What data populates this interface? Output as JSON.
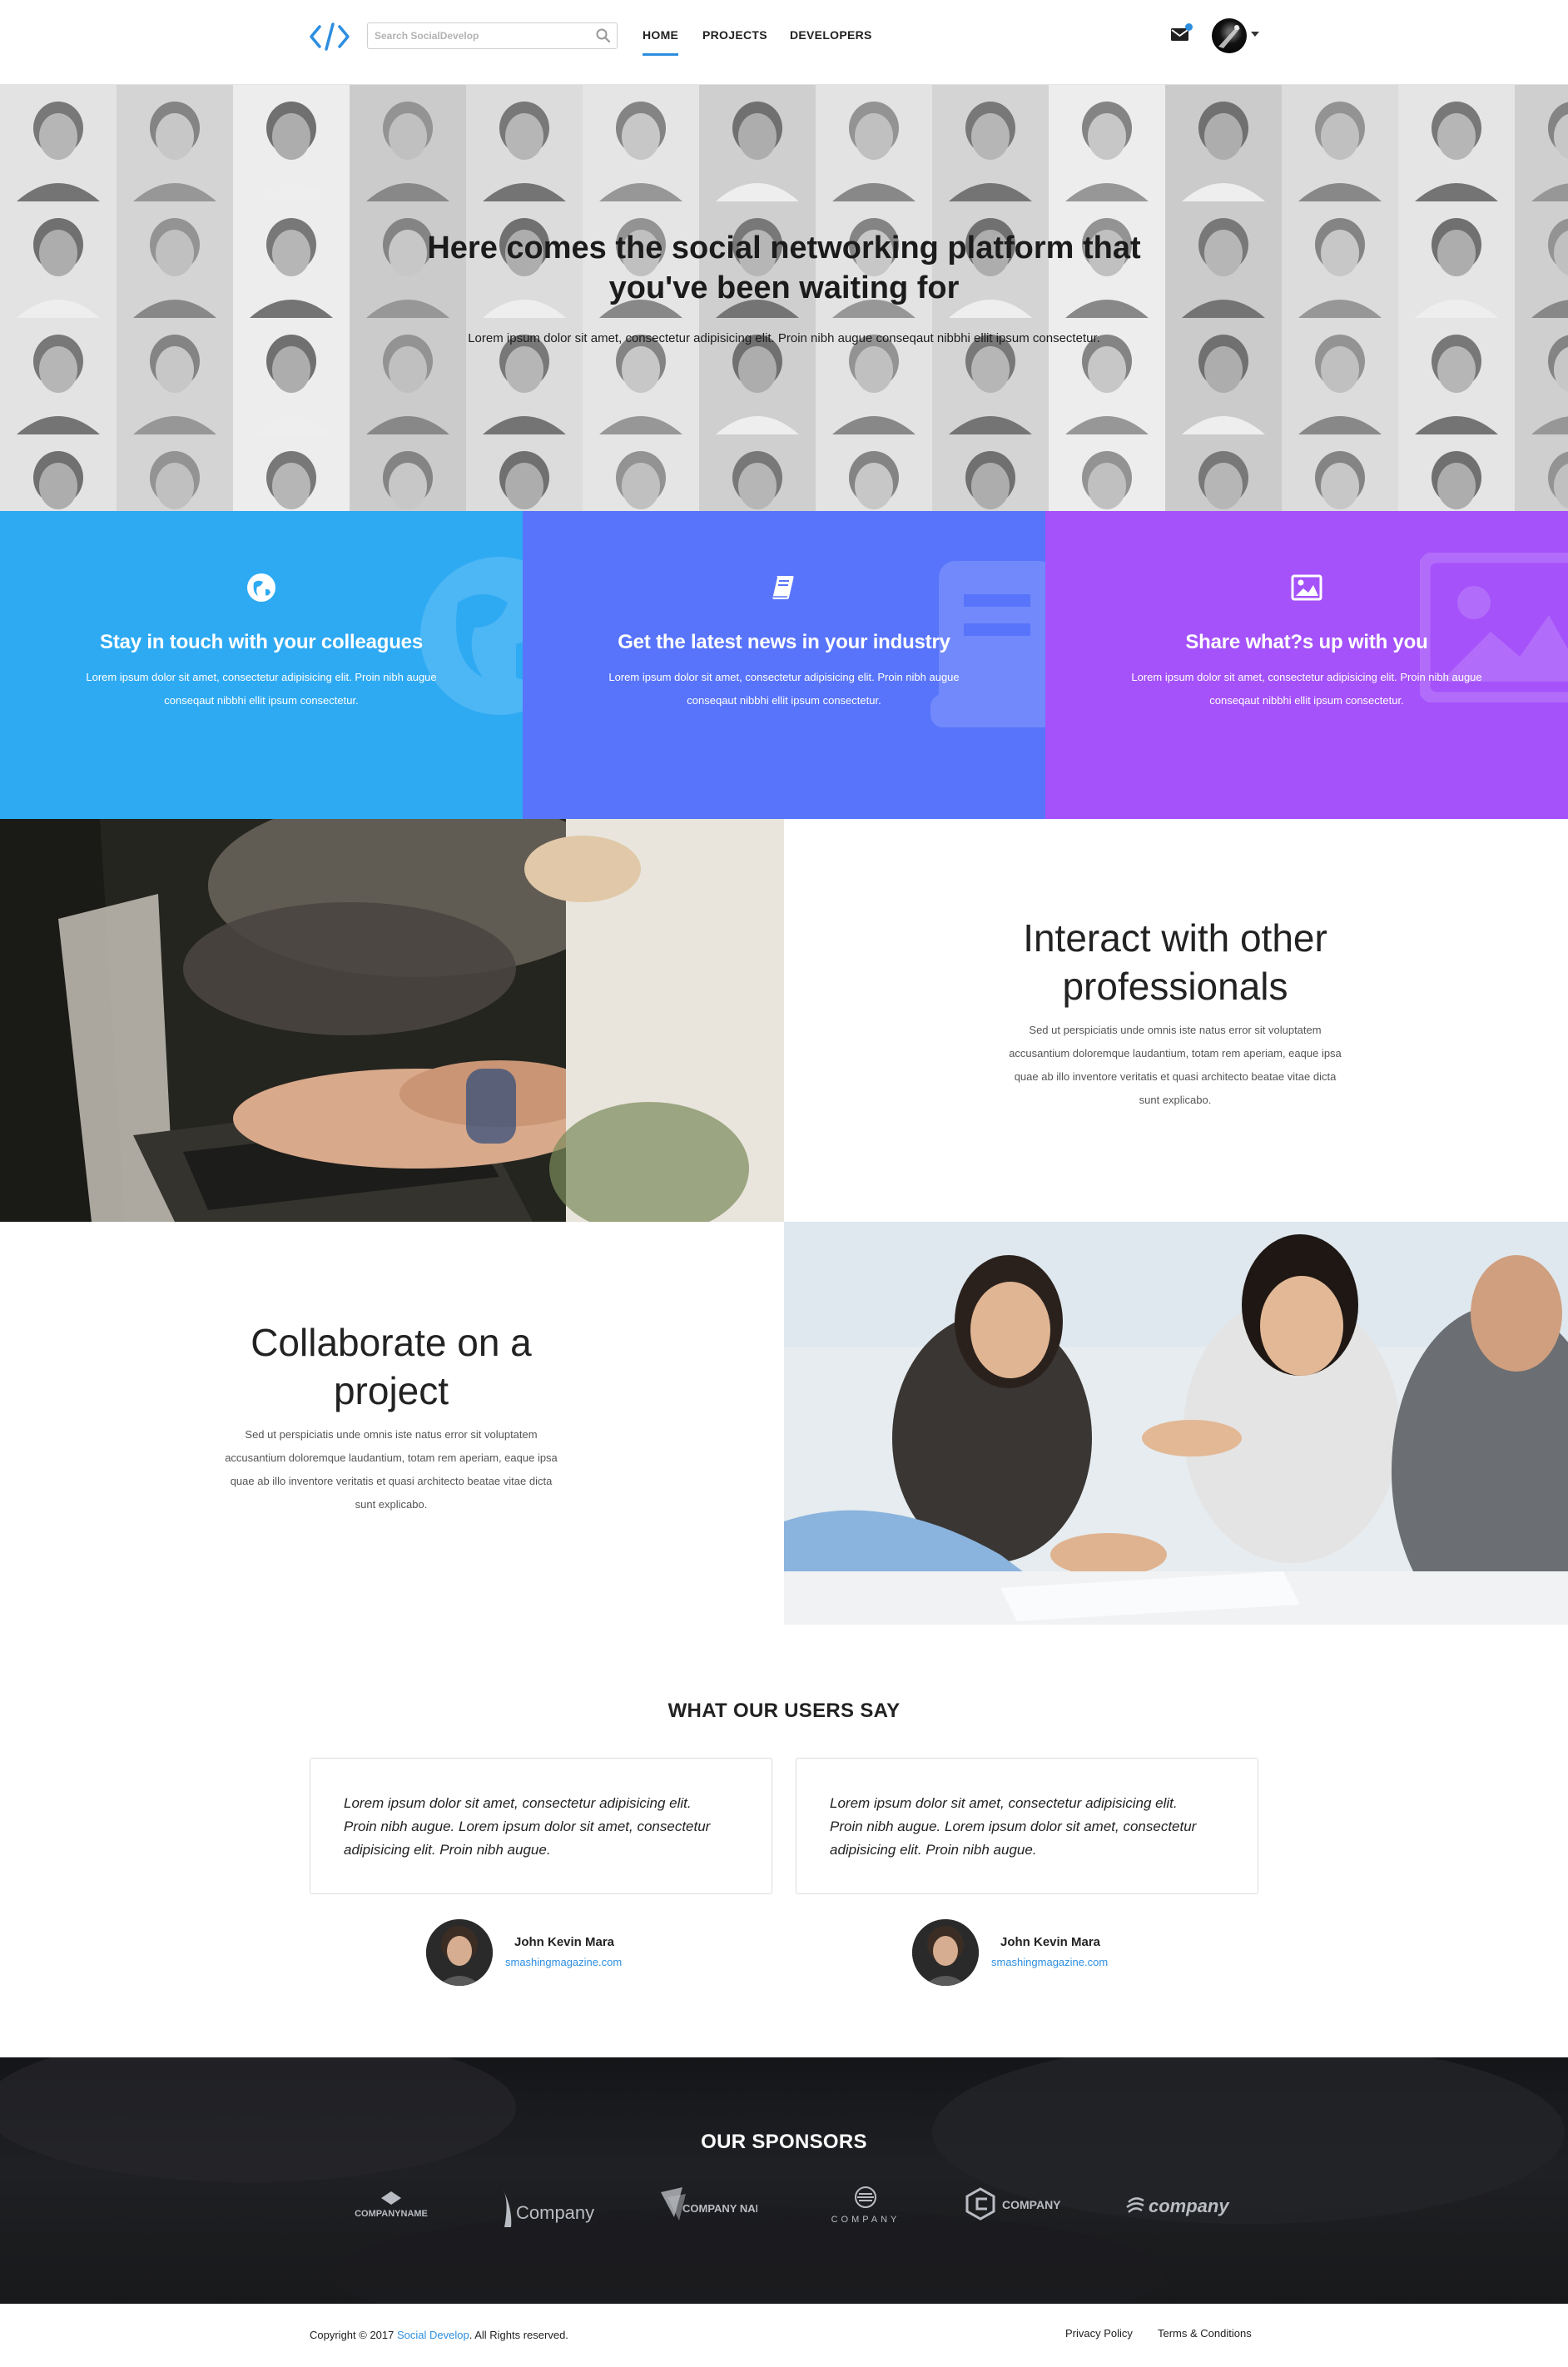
{
  "navbar": {
    "search_placeholder": "Search SocialDevelop",
    "nav": [
      "HOME",
      "PROJECTS",
      "DEVELOPERS"
    ],
    "active_nav": "HOME"
  },
  "hero": {
    "title_line1": "Here comes the social networking platform that",
    "title_line2": "you've been waiting for",
    "subtitle": "Lorem ipsum dolor sit amet, consectetur adipisicing elit. Proin nibh augue conseqaut nibbhi ellit ipsum consectetur."
  },
  "features": [
    {
      "title": "Stay in touch with your colleagues",
      "text_line1": "Lorem ipsum dolor sit amet, consectetur adipisicing elit. Proin nibh augue",
      "text_line2": "conseqaut nibbhi ellit ipsum consectetur.",
      "icon": "globe-icon",
      "color": "#2eaaf3"
    },
    {
      "title": "Get the latest news in your industry",
      "text_line1": "Lorem ipsum dolor sit amet, consectetur adipisicing elit. Proin nibh augue",
      "text_line2": "conseqaut nibbhi ellit ipsum consectetur.",
      "icon": "book-icon",
      "color": "#5874fb"
    },
    {
      "title": "Share what?s up with you",
      "text_line1": "Lorem ipsum dolor sit amet, consectetur adipisicing elit. Proin nibh augue",
      "text_line2": "conseqaut nibbhi ellit ipsum consectetur.",
      "icon": "image-icon",
      "color": "#a552fa"
    }
  ],
  "interact": {
    "title_line1": "Interact with other",
    "title_line2": "professionals",
    "text_line1": "Sed ut perspiciatis unde omnis iste natus error sit voluptatem",
    "text_line2": "accusantium doloremque laudantium, totam rem aperiam, eaque ipsa",
    "text_line3": "quae ab illo inventore veritatis et quasi architecto beatae vitae dicta",
    "text_line4": "sunt explicabo."
  },
  "collaborate": {
    "title_line1": "Collaborate on a",
    "title_line2": "project",
    "text_line1": "Sed ut perspiciatis unde omnis iste natus error sit voluptatem",
    "text_line2": "accusantium doloremque laudantium, totam rem aperiam, eaque ipsa",
    "text_line3": "quae ab illo inventore veritatis et quasi architecto beatae vitae dicta",
    "text_line4": "sunt explicabo."
  },
  "testimonials": {
    "heading": "WHAT OUR USERS SAY",
    "items": [
      {
        "quote_line1": "Lorem ipsum dolor sit amet, consectetur adipisicing elit.",
        "quote_line2": "Proin nibh augue. Lorem ipsum dolor sit amet, consectetur",
        "quote_line3": "adipisicing elit. Proin nibh augue.",
        "name": "John Kevin Mara",
        "site": "smashingmagazine.com"
      },
      {
        "quote_line1": "Lorem ipsum dolor sit amet, consectetur adipisicing elit.",
        "quote_line2": "Proin nibh augue. Lorem ipsum dolor sit amet, consectetur",
        "quote_line3": "adipisicing elit. Proin nibh augue.",
        "name": "John Kevin Mara",
        "site": "smashingmagazine.com"
      }
    ]
  },
  "sponsors": {
    "heading": "OUR SPONSORS",
    "logos": [
      "COMPANYNAME",
      "Company",
      "COMPANY NAME",
      "COMPANY",
      "COMPANY",
      "company"
    ]
  },
  "footer": {
    "copy_prefix": "Copyright © 2017",
    "brand_link": "Social Develop",
    "copy_suffix": ". All Rights reserved.",
    "privacy": "Privacy Policy",
    "terms": "Terms & Conditions"
  }
}
